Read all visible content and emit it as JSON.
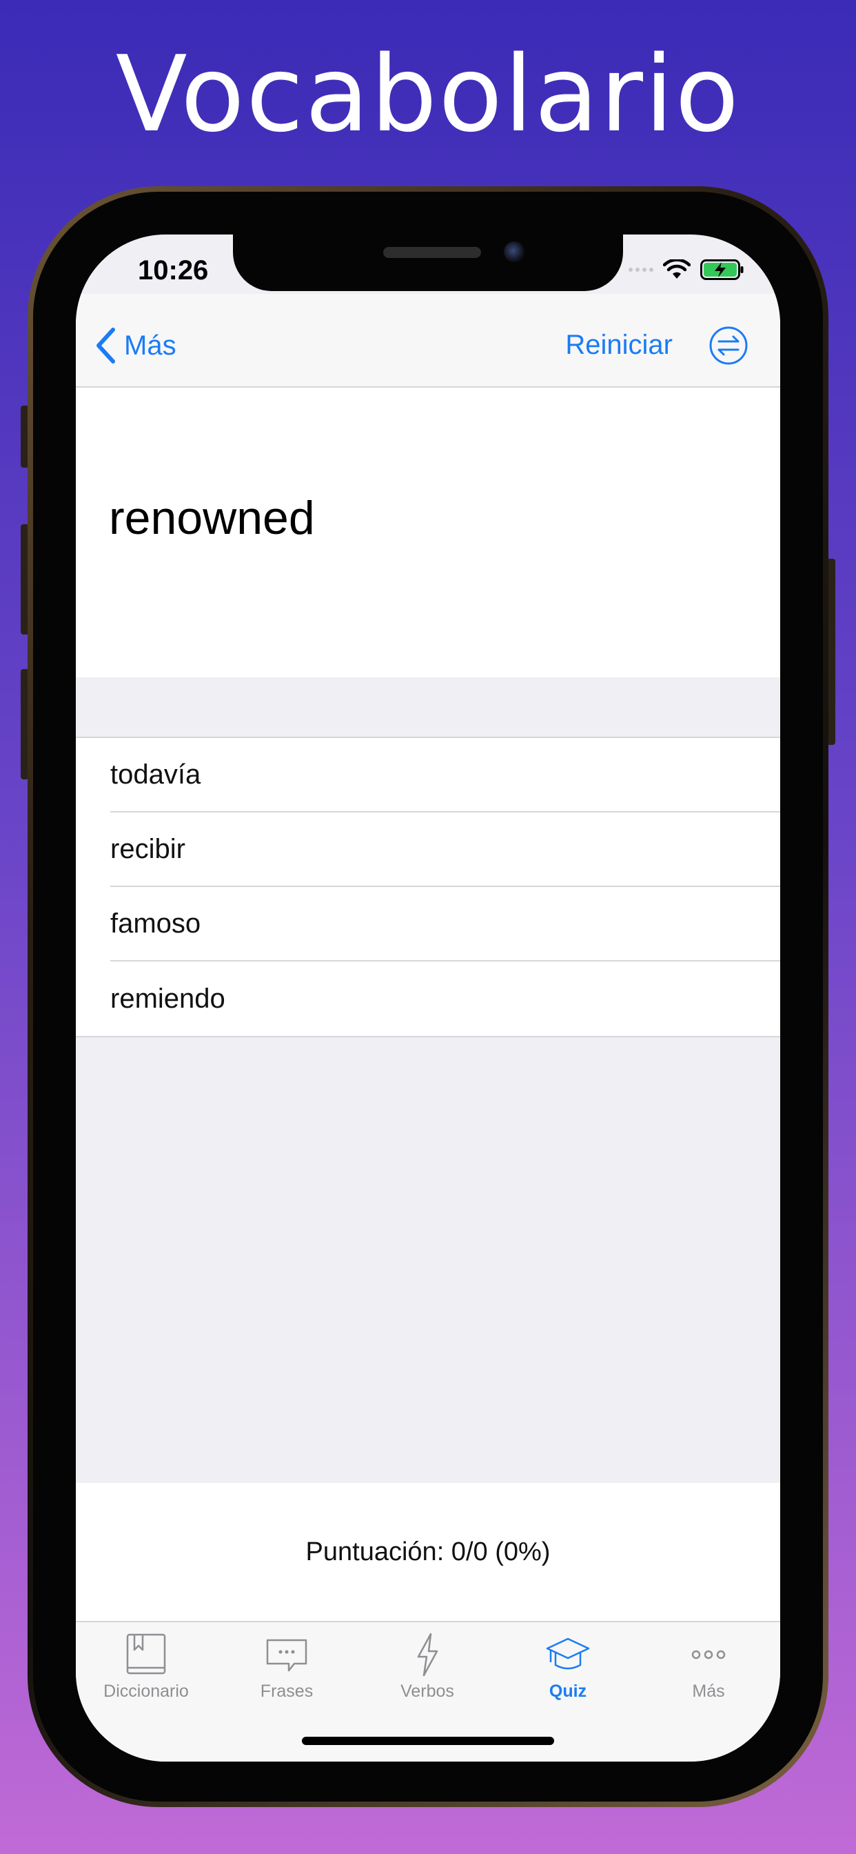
{
  "promo": {
    "headline": "Vocabolario"
  },
  "status_bar": {
    "time": "10:26"
  },
  "nav": {
    "back_label": "Más",
    "reset_label": "Reiniciar"
  },
  "quiz": {
    "question": "renowned",
    "answers": [
      "todavía",
      "recibir",
      "famoso",
      "remiendo"
    ],
    "score": "Puntuación: 0/0 (0%)"
  },
  "tabs": [
    {
      "label": "Diccionario",
      "icon": "book-icon",
      "active": false
    },
    {
      "label": "Frases",
      "icon": "speech-bubble-icon",
      "active": false
    },
    {
      "label": "Verbos",
      "icon": "lightning-icon",
      "active": false
    },
    {
      "label": "Quiz",
      "icon": "graduation-cap-icon",
      "active": true
    },
    {
      "label": "Más",
      "icon": "more-dots-icon",
      "active": false
    }
  ],
  "colors": {
    "accent": "#1a7cf5",
    "inactive": "#8e8e93",
    "background_gradient_top": "#3b2bb6",
    "background_gradient_bottom": "#c06ad6"
  }
}
